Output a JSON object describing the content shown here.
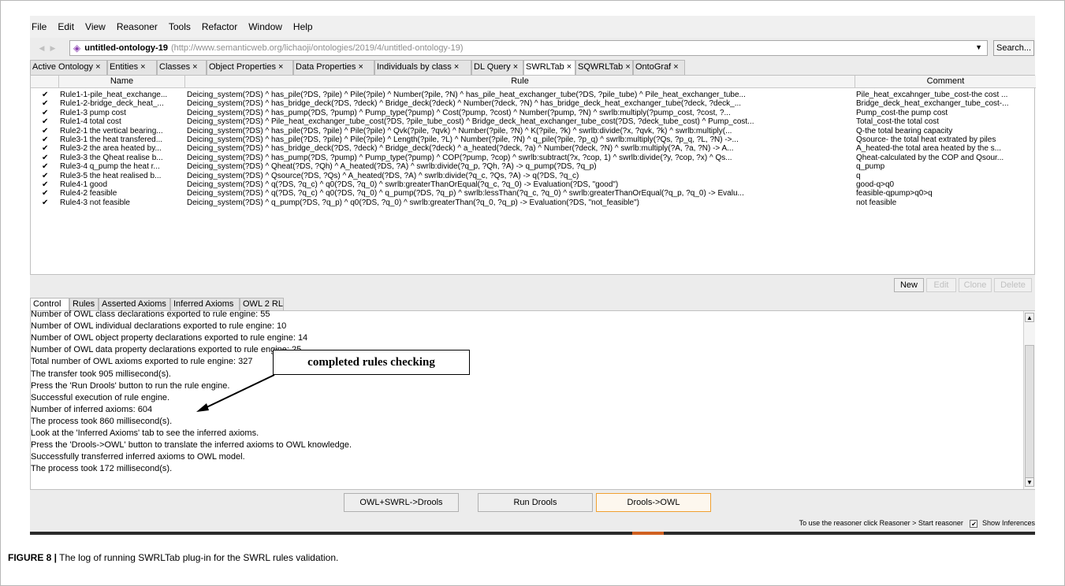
{
  "menu": [
    "File",
    "Edit",
    "View",
    "Reasoner",
    "Tools",
    "Refactor",
    "Window",
    "Help"
  ],
  "address": {
    "ontology_name": "untitled-ontology-19",
    "ontology_url": "(http://www.semanticweb.org/lichaoji/ontologies/2019/4/untitled-ontology-19)",
    "search_label": "Search..."
  },
  "tabs": [
    "Active Ontology",
    "Entities",
    "Classes",
    "Object Properties",
    "Data Properties",
    "Individuals by class",
    "DL Query",
    "SWRLTab",
    "SQWRLTab",
    "OntoGraf"
  ],
  "active_tab": "SWRLTab",
  "table": {
    "headers": {
      "name": "Name",
      "rule": "Rule",
      "comment": "Comment"
    },
    "rows": [
      {
        "checked": "✔",
        "name": "Rule1-1-pile_heat_exchange...",
        "rule": "Deicing_system(?DS) ^ has_pile(?DS, ?pile) ^ Pile(?pile) ^ Number(?pile, ?N) ^ has_pile_heat_exchanger_tube(?DS, ?pile_tube) ^ Pile_heat_exchanger_tube...",
        "comment": "Pile_heat_excahnger_tube_cost-the cost ..."
      },
      {
        "checked": "✔",
        "name": "Rule1-2-bridge_deck_heat_...",
        "rule": "Deicing_system(?DS) ^ has_bridge_deck(?DS, ?deck) ^ Bridge_deck(?deck) ^ Number(?deck, ?N) ^ has_bridge_deck_heat_exchanger_tube(?deck, ?deck_...",
        "comment": "Bridge_deck_heat_exchanger_tube_cost-..."
      },
      {
        "checked": "✔",
        "name": "Rule1-3 pump cost",
        "rule": "Deicing_system(?DS) ^ has_pump(?DS, ?pump) ^ Pump_type(?pump) ^ Cost(?pump, ?cost) ^ Number(?pump, ?N) ^ swrlb:multiply(?pump_cost, ?cost, ?...",
        "comment": "Pump_cost-the pump cost"
      },
      {
        "checked": "✔",
        "name": "Rule1-4 total cost",
        "rule": "Deicing_system(?DS) ^ Pile_heat_exchanger_tube_cost(?DS, ?pile_tube_cost) ^ Bridge_deck_heat_exchanger_tube_cost(?DS, ?deck_tube_cost) ^ Pump_cost...",
        "comment": "Total_cost-the total cost"
      },
      {
        "checked": "✔",
        "name": "Rule2-1 the vertical bearing...",
        "rule": "Deicing_system(?DS) ^ has_pile(?DS, ?pile) ^ Pile(?pile) ^ Qvk(?pile, ?qvk) ^ Number(?pile, ?N) ^ K(?pile, ?k) ^ swrlb:divide(?x, ?qvk, ?k) ^ swrlb:multiply(...",
        "comment": "Q-the total bearing capacity"
      },
      {
        "checked": "✔",
        "name": "Rule3-1 the heat transfered...",
        "rule": "Deicing_system(?DS) ^ has_pile(?DS, ?pile) ^ Pile(?pile) ^ Length(?pile, ?L) ^ Number(?pile, ?N) ^ q_pile(?pile, ?p_q) ^ swrlb:multiply(?Qs, ?p_q, ?L, ?N) ->...",
        "comment": "Qsource- the total heat extrated by piles"
      },
      {
        "checked": "✔",
        "name": "Rule3-2 the area heated by...",
        "rule": "Deicing_system(?DS) ^ has_bridge_deck(?DS, ?deck) ^ Bridge_deck(?deck) ^ a_heated(?deck, ?a) ^ Number(?deck, ?N) ^ swrlb:multiply(?A, ?a, ?N) -> A...",
        "comment": "A_heated-the total area heated by the s..."
      },
      {
        "checked": "✔",
        "name": "Rule3-3 the Qheat realise b...",
        "rule": "Deicing_system(?DS) ^ has_pump(?DS, ?pump) ^ Pump_type(?pump) ^ COP(?pump, ?cop) ^ swrlb:subtract(?x, ?cop, 1) ^ swrlb:divide(?y, ?cop, ?x) ^ Qs...",
        "comment": "Qheat-calculated by the COP and Qsour..."
      },
      {
        "checked": "✔",
        "name": "Rule3-4 q_pump the heat r...",
        "rule": "Deicing_system(?DS) ^ Qheat(?DS, ?Qh) ^ A_heated(?DS, ?A) ^ swrlb:divide(?q_p, ?Qh, ?A) -> q_pump(?DS, ?q_p)",
        "comment": "q_pump"
      },
      {
        "checked": "✔",
        "name": "Rule3-5 the heat realised b...",
        "rule": "Deicing_system(?DS) ^ Qsource(?DS, ?Qs) ^ A_heated(?DS, ?A) ^ swrlb:divide(?q_c, ?Qs, ?A) -> q(?DS, ?q_c)",
        "comment": "q"
      },
      {
        "checked": "✔",
        "name": "Rule4-1 good",
        "rule": "Deicing_system(?DS) ^ q(?DS, ?q_c) ^ q0(?DS, ?q_0) ^ swrlb:greaterThanOrEqual(?q_c, ?q_0) -> Evaluation(?DS, \"good\")",
        "comment": "good-q>q0"
      },
      {
        "checked": "✔",
        "name": "Rule4-2 feasible",
        "rule": "Deicing_system(?DS) ^ q(?DS, ?q_c) ^ q0(?DS, ?q_0) ^ q_pump(?DS, ?q_p) ^ swrlb:lessThan(?q_c, ?q_0) ^ swrlb:greaterThanOrEqual(?q_p, ?q_0) -> Evalu...",
        "comment": "feasible-qpump>q0>q"
      },
      {
        "checked": "✔",
        "name": "Rule4-3 not feasible",
        "rule": "Deicing_system(?DS) ^ q_pump(?DS, ?q_p) ^ q0(?DS, ?q_0) ^ swrlb:greaterThan(?q_0, ?q_p) -> Evaluation(?DS, \"not_feasible\")",
        "comment": "not feasible"
      }
    ]
  },
  "table_buttons": {
    "new": "New",
    "edit": "Edit",
    "clone": "Clone",
    "delete": "Delete"
  },
  "subtabs": [
    "Control",
    "Rules",
    "Asserted Axioms",
    "Inferred Axioms",
    "OWL 2 RL"
  ],
  "log": [
    "Number of OWL class declarations exported to rule engine: 55",
    "Number of OWL individual declarations exported to rule engine: 10",
    "Number of OWL object property declarations exported to rule engine: 14",
    "Number of OWL data property declarations exported to rule engine: 25",
    "Total number of OWL axioms exported to rule engine: 327",
    "The transfer took 905 millisecond(s).",
    "Press the 'Run Drools' button to run the rule engine.",
    "Successful execution of rule engine.",
    "Number of inferred axioms: 604",
    "The process took 860 millisecond(s).",
    "Look at the 'Inferred Axioms' tab to see the inferred axioms.",
    "Press the 'Drools->OWL' button to translate the inferred axioms to OWL knowledge.",
    "Successfully transferred inferred axioms to OWL model.",
    "The process took 172 millisecond(s)."
  ],
  "annotation": "completed rules checking",
  "bottom_buttons": {
    "owl_swrl": "OWL+SWRL->Drools",
    "run": "Run Drools",
    "drools_owl": "Drools->OWL"
  },
  "status": {
    "hint": "To use the reasoner click Reasoner > Start reasoner",
    "show_inferences": "Show Inferences",
    "check": "✔"
  },
  "caption": {
    "label": "FIGURE 8 |",
    "text": " The log of running SWRLTab plug-in for the SWRL rules validation."
  }
}
